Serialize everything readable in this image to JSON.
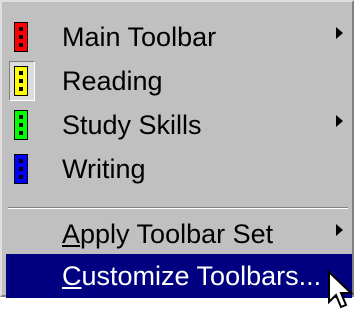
{
  "menu": {
    "items": [
      {
        "label": "Main Toolbar",
        "has_submenu": true,
        "icon": "red-toolbar-icon",
        "icon_color": "#ff0000"
      },
      {
        "label": "Reading",
        "has_submenu": false,
        "checked": true,
        "icon": "yellow-toolbar-icon",
        "icon_color": "#ffff00"
      },
      {
        "label": "Study Skills",
        "has_submenu": true,
        "icon": "green-toolbar-icon",
        "icon_color": "#00ff00"
      },
      {
        "label": "Writing",
        "has_submenu": false,
        "icon": "blue-toolbar-icon",
        "icon_color": "#0000ff"
      }
    ],
    "actions": [
      {
        "mnemonic": "A",
        "rest": "pply Toolbar Set",
        "has_submenu": true
      },
      {
        "mnemonic": "C",
        "rest": "ustomize Toolbars...",
        "has_submenu": false,
        "selected": true
      }
    ]
  },
  "colors": {
    "menu_bg": "#c0c0c0",
    "highlight": "#000080"
  }
}
